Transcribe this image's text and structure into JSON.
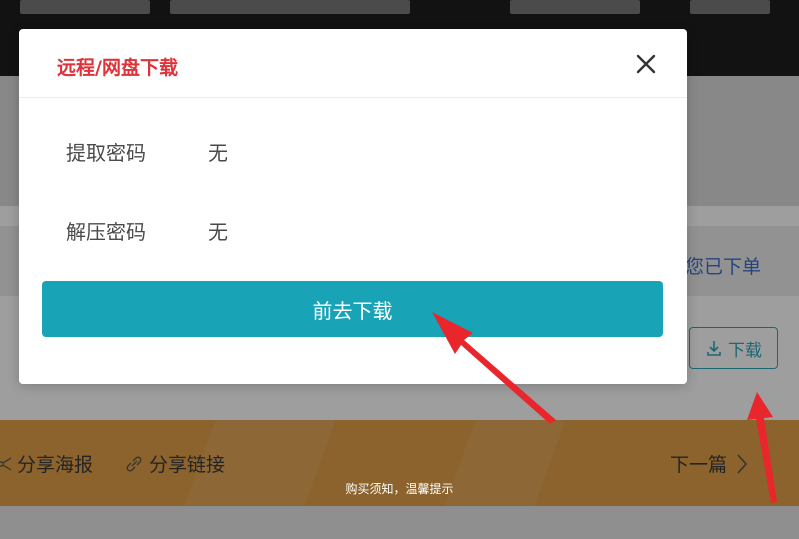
{
  "modal": {
    "title": "远程/网盘下载",
    "fields": [
      {
        "label": "提取密码",
        "value": "无"
      },
      {
        "label": "解压密码",
        "value": "无"
      }
    ],
    "primary_button": "前去下载",
    "close_icon": "close-icon"
  },
  "background": {
    "ordered_text": "您已下单",
    "download_button": "下载",
    "share_poster": "分享海报",
    "share_link": "分享链接",
    "next_article": "下一篇",
    "purchase_note": "购买须知，温馨提示"
  },
  "colors": {
    "title_red": "#e0323a",
    "primary_teal": "#19a3b7",
    "link_blue": "#3f6fd0",
    "strip_orange": "#e2a04a",
    "arrow_red": "#e8262c"
  }
}
